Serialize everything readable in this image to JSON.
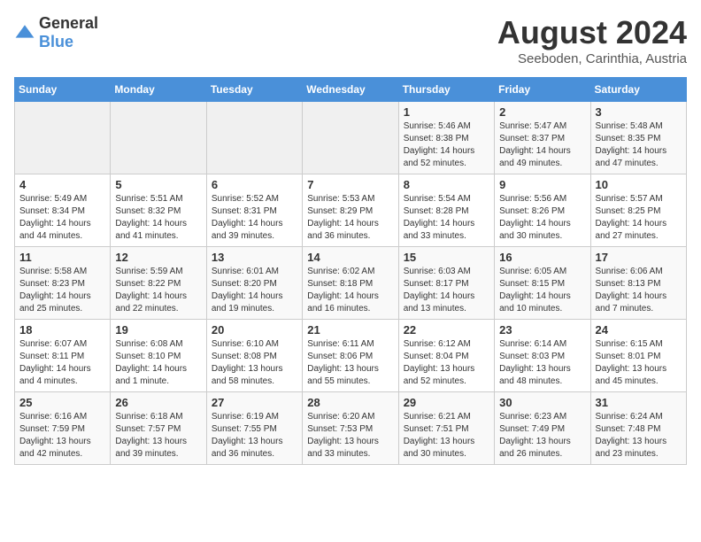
{
  "header": {
    "logo_general": "General",
    "logo_blue": "Blue",
    "month_year": "August 2024",
    "location": "Seeboden, Carinthia, Austria"
  },
  "days_of_week": [
    "Sunday",
    "Monday",
    "Tuesday",
    "Wednesday",
    "Thursday",
    "Friday",
    "Saturday"
  ],
  "weeks": [
    [
      {
        "day": "",
        "info": ""
      },
      {
        "day": "",
        "info": ""
      },
      {
        "day": "",
        "info": ""
      },
      {
        "day": "",
        "info": ""
      },
      {
        "day": "1",
        "info": "Sunrise: 5:46 AM\nSunset: 8:38 PM\nDaylight: 14 hours\nand 52 minutes."
      },
      {
        "day": "2",
        "info": "Sunrise: 5:47 AM\nSunset: 8:37 PM\nDaylight: 14 hours\nand 49 minutes."
      },
      {
        "day": "3",
        "info": "Sunrise: 5:48 AM\nSunset: 8:35 PM\nDaylight: 14 hours\nand 47 minutes."
      }
    ],
    [
      {
        "day": "4",
        "info": "Sunrise: 5:49 AM\nSunset: 8:34 PM\nDaylight: 14 hours\nand 44 minutes."
      },
      {
        "day": "5",
        "info": "Sunrise: 5:51 AM\nSunset: 8:32 PM\nDaylight: 14 hours\nand 41 minutes."
      },
      {
        "day": "6",
        "info": "Sunrise: 5:52 AM\nSunset: 8:31 PM\nDaylight: 14 hours\nand 39 minutes."
      },
      {
        "day": "7",
        "info": "Sunrise: 5:53 AM\nSunset: 8:29 PM\nDaylight: 14 hours\nand 36 minutes."
      },
      {
        "day": "8",
        "info": "Sunrise: 5:54 AM\nSunset: 8:28 PM\nDaylight: 14 hours\nand 33 minutes."
      },
      {
        "day": "9",
        "info": "Sunrise: 5:56 AM\nSunset: 8:26 PM\nDaylight: 14 hours\nand 30 minutes."
      },
      {
        "day": "10",
        "info": "Sunrise: 5:57 AM\nSunset: 8:25 PM\nDaylight: 14 hours\nand 27 minutes."
      }
    ],
    [
      {
        "day": "11",
        "info": "Sunrise: 5:58 AM\nSunset: 8:23 PM\nDaylight: 14 hours\nand 25 minutes."
      },
      {
        "day": "12",
        "info": "Sunrise: 5:59 AM\nSunset: 8:22 PM\nDaylight: 14 hours\nand 22 minutes."
      },
      {
        "day": "13",
        "info": "Sunrise: 6:01 AM\nSunset: 8:20 PM\nDaylight: 14 hours\nand 19 minutes."
      },
      {
        "day": "14",
        "info": "Sunrise: 6:02 AM\nSunset: 8:18 PM\nDaylight: 14 hours\nand 16 minutes."
      },
      {
        "day": "15",
        "info": "Sunrise: 6:03 AM\nSunset: 8:17 PM\nDaylight: 14 hours\nand 13 minutes."
      },
      {
        "day": "16",
        "info": "Sunrise: 6:05 AM\nSunset: 8:15 PM\nDaylight: 14 hours\nand 10 minutes."
      },
      {
        "day": "17",
        "info": "Sunrise: 6:06 AM\nSunset: 8:13 PM\nDaylight: 14 hours\nand 7 minutes."
      }
    ],
    [
      {
        "day": "18",
        "info": "Sunrise: 6:07 AM\nSunset: 8:11 PM\nDaylight: 14 hours\nand 4 minutes."
      },
      {
        "day": "19",
        "info": "Sunrise: 6:08 AM\nSunset: 8:10 PM\nDaylight: 14 hours\nand 1 minute."
      },
      {
        "day": "20",
        "info": "Sunrise: 6:10 AM\nSunset: 8:08 PM\nDaylight: 13 hours\nand 58 minutes."
      },
      {
        "day": "21",
        "info": "Sunrise: 6:11 AM\nSunset: 8:06 PM\nDaylight: 13 hours\nand 55 minutes."
      },
      {
        "day": "22",
        "info": "Sunrise: 6:12 AM\nSunset: 8:04 PM\nDaylight: 13 hours\nand 52 minutes."
      },
      {
        "day": "23",
        "info": "Sunrise: 6:14 AM\nSunset: 8:03 PM\nDaylight: 13 hours\nand 48 minutes."
      },
      {
        "day": "24",
        "info": "Sunrise: 6:15 AM\nSunset: 8:01 PM\nDaylight: 13 hours\nand 45 minutes."
      }
    ],
    [
      {
        "day": "25",
        "info": "Sunrise: 6:16 AM\nSunset: 7:59 PM\nDaylight: 13 hours\nand 42 minutes."
      },
      {
        "day": "26",
        "info": "Sunrise: 6:18 AM\nSunset: 7:57 PM\nDaylight: 13 hours\nand 39 minutes."
      },
      {
        "day": "27",
        "info": "Sunrise: 6:19 AM\nSunset: 7:55 PM\nDaylight: 13 hours\nand 36 minutes."
      },
      {
        "day": "28",
        "info": "Sunrise: 6:20 AM\nSunset: 7:53 PM\nDaylight: 13 hours\nand 33 minutes."
      },
      {
        "day": "29",
        "info": "Sunrise: 6:21 AM\nSunset: 7:51 PM\nDaylight: 13 hours\nand 30 minutes."
      },
      {
        "day": "30",
        "info": "Sunrise: 6:23 AM\nSunset: 7:49 PM\nDaylight: 13 hours\nand 26 minutes."
      },
      {
        "day": "31",
        "info": "Sunrise: 6:24 AM\nSunset: 7:48 PM\nDaylight: 13 hours\nand 23 minutes."
      }
    ]
  ]
}
